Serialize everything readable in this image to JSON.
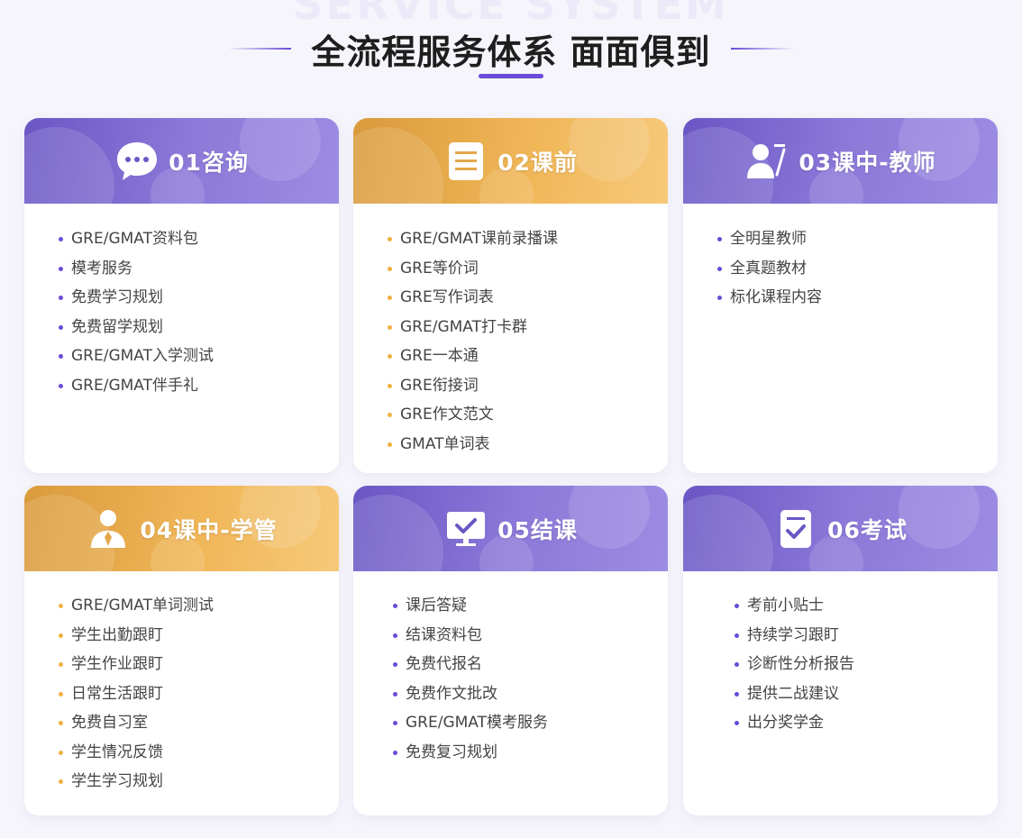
{
  "header": {
    "watermark": "SERVICE SYSTEM",
    "title": "全流程服务体系 面面俱到"
  },
  "colors": {
    "accent_purple": "#6a4ad6",
    "accent_orange": "#f0b040"
  },
  "cards": [
    {
      "title": "01咨询",
      "icon": "chat-bubble-icon",
      "theme": "purple",
      "items": [
        "GRE/GMAT资料包",
        "模考服务",
        "免费学习规划",
        "免费留学规划",
        "GRE/GMAT入学测试",
        "GRE/GMAT伴手礼"
      ]
    },
    {
      "title": "02课前",
      "icon": "document-icon",
      "theme": "orange",
      "items": [
        "GRE/GMAT课前录播课",
        "GRE等价词",
        "GRE写作词表",
        "GRE/GMAT打卡群",
        "GRE一本通",
        "GRE衔接词",
        "GRE作文范文",
        "GMAT单词表"
      ]
    },
    {
      "title": "03课中-教师",
      "icon": "teacher-icon",
      "theme": "purple",
      "items": [
        "全明星教师",
        "全真题教材",
        "标化课程内容"
      ]
    },
    {
      "title": "04课中-学管",
      "icon": "manager-icon",
      "theme": "orange",
      "items": [
        "GRE/GMAT单词测试",
        "学生出勤跟盯",
        "学生作业跟盯",
        "日常生活跟盯",
        "免费自习室",
        "学生情况反馈",
        "学生学习规划"
      ]
    },
    {
      "title": "05结课",
      "icon": "monitor-check-icon",
      "theme": "purple",
      "items": [
        "课后答疑",
        "结课资料包",
        "免费代报名",
        "免费作文批改",
        "GRE/GMAT模考服务",
        "免费复习规划"
      ]
    },
    {
      "title": "06考试",
      "icon": "checklist-icon",
      "theme": "purple",
      "items": [
        "考前小贴士",
        "持续学习跟盯",
        "诊断性分析报告",
        "提供二战建议",
        "出分奖学金"
      ]
    }
  ]
}
